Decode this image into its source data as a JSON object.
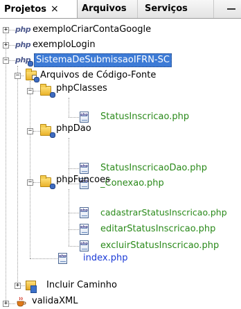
{
  "tabs": [
    {
      "label": "Projetos",
      "close": "×",
      "active": true
    },
    {
      "label": "Arquivos",
      "active": false
    },
    {
      "label": "Serviços",
      "active": false
    }
  ],
  "colors": {
    "source_file_text": "#2a8a1a",
    "index_file_text": "#1a3ad6",
    "selection_bg": "#3d7bd6"
  },
  "tree": {
    "project1": {
      "label": "exemploCriarContaGoogle",
      "icon": "php-project-icon",
      "toggle": "+"
    },
    "project2": {
      "label": "exemploLogin",
      "icon": "php-project-icon",
      "toggle": "+"
    },
    "project3": {
      "label": "SistemaDeSubmissaoIFRN-SC",
      "icon": "php-project-icon",
      "toggle": "−",
      "selected": true
    },
    "source_root": {
      "label": "Arquivos de Código-Fonte",
      "icon": "source-folder-icon",
      "toggle": "−"
    },
    "pkg_classes": {
      "label": "phpClasses",
      "icon": "package-folder-icon",
      "toggle": "−"
    },
    "file_status": {
      "label": "StatusInscricao.php",
      "icon": "php-file-icon"
    },
    "pkg_dao": {
      "label": "phpDao",
      "icon": "package-folder-icon",
      "toggle": "−"
    },
    "file_status_dao": {
      "label": "StatusInscricaoDao.php",
      "icon": "php-file-icon"
    },
    "file_conexao": {
      "label": "_Conexao.php",
      "icon": "php-file-icon"
    },
    "pkg_funcoes": {
      "label": "phpFuncoes",
      "icon": "package-folder-icon",
      "toggle": "−"
    },
    "file_cadastrar": {
      "label": "cadastrarStatusInscricao.php",
      "icon": "php-file-icon"
    },
    "file_editar": {
      "label": "editarStatusInscricao.php",
      "icon": "php-file-icon"
    },
    "file_excluir": {
      "label": "excluirStatusInscricao.php",
      "icon": "php-file-icon"
    },
    "file_index": {
      "label": "index.php",
      "icon": "php-file-icon"
    },
    "include_path": {
      "label": "Incluir Caminho",
      "icon": "library-folder-icon",
      "toggle": "+"
    },
    "project4": {
      "label": "validaXML",
      "icon": "java-project-icon",
      "toggle": "+"
    }
  }
}
